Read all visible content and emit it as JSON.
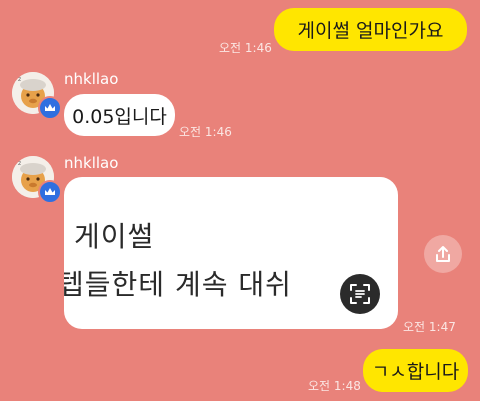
{
  "messages": [
    {
      "side": "mine",
      "text": "게이썰 얼마인가요",
      "time": "오전 1:46"
    },
    {
      "side": "theirs",
      "sender": "nhkllao",
      "text": "0.05입니다",
      "time": "오전 1:46"
    },
    {
      "side": "theirs",
      "sender": "nhkllao",
      "type": "image",
      "image_text": [
        "게이썰",
        "텝들한테 계속 대쉬"
      ],
      "time": "오전 1:47"
    },
    {
      "side": "mine",
      "text": "ㄱㅅ합니다",
      "time": "오전 1:48"
    }
  ],
  "icons": {
    "share": "share-icon",
    "scan": "text-scan-icon",
    "crown": "crown-icon"
  },
  "colors": {
    "background": "#e9827a",
    "my_bubble": "#ffe600",
    "their_bubble": "#ffffff",
    "badge": "#2f6fe0"
  }
}
